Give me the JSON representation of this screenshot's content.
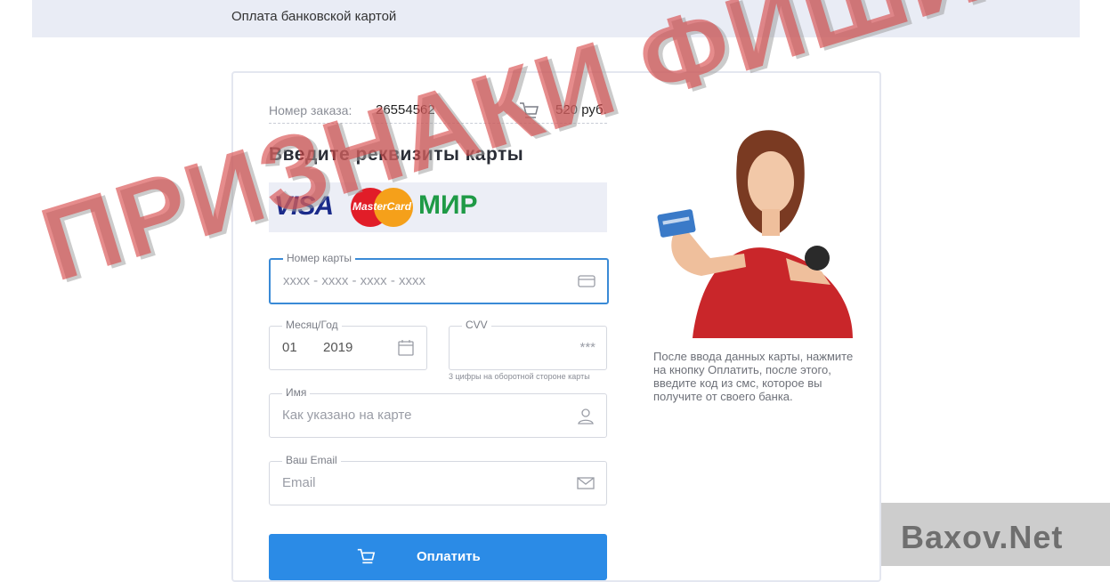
{
  "topbar": {
    "title": "Оплата банковской картой"
  },
  "order": {
    "label": "Номер заказа:",
    "number": "26554562",
    "amount": "520 руб."
  },
  "form": {
    "heading": "Введите реквизиты карты",
    "logos": {
      "visa": "VISA",
      "mastercard": "MasterCard",
      "mir": "МИР"
    },
    "card_number": {
      "label": "Номер карты",
      "placeholder": "xxxx - xxxx - xxxx - xxxx"
    },
    "expiry": {
      "label": "Месяц/Год",
      "month": "01",
      "year": "2019"
    },
    "cvv": {
      "label": "CVV",
      "value": "***",
      "hint": "3 цифры на оборотной стороне карты"
    },
    "name": {
      "label": "Имя",
      "placeholder": "Как указано на карте"
    },
    "email": {
      "label": "Ваш Email",
      "placeholder": "Email"
    },
    "pay_button": "Оплатить"
  },
  "side_text": "После ввода данных карты, нажмите на кнопку Оплатить, после этого, введите код из смс, которое вы получите от своего банка.",
  "stamp_text": "ПРИЗНАКИ ФИШИНГА",
  "watermark": "Baxov.Net",
  "colors": {
    "accent": "#2b8be6",
    "stamp": "#d64646",
    "visa": "#1a2a8a",
    "mir": "#1f9a46"
  }
}
